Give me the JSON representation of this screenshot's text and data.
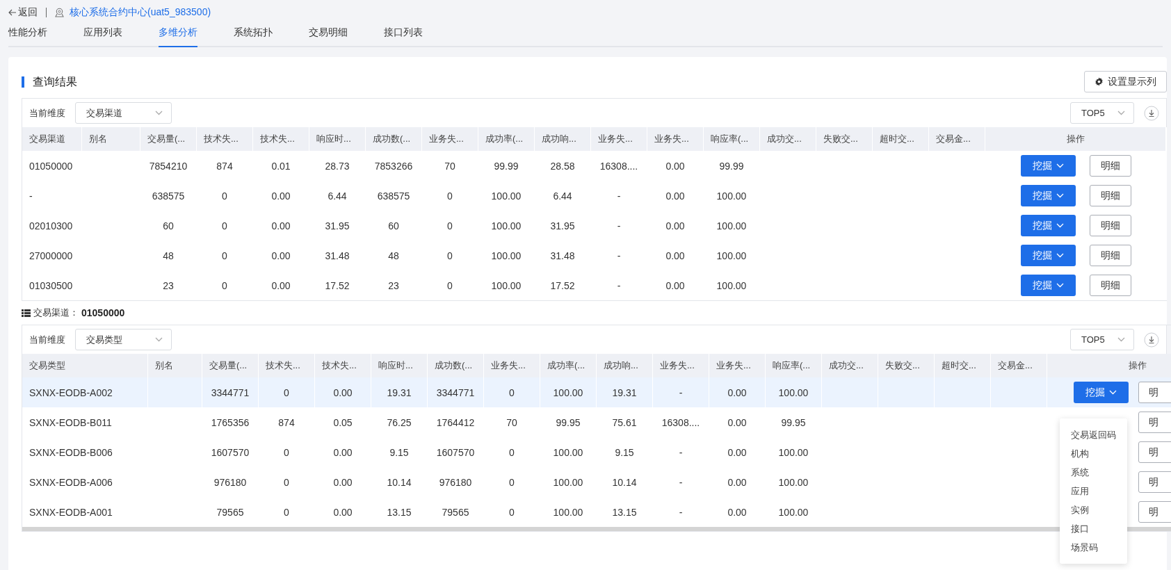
{
  "header": {
    "back": "返回",
    "app_name": "核心系统合约中心(uat5_983500)"
  },
  "tabs": [
    {
      "label": "性能分析",
      "selected": false
    },
    {
      "label": "应用列表",
      "selected": false
    },
    {
      "label": "多维分析",
      "selected": true
    },
    {
      "label": "系统拓扑",
      "selected": false
    },
    {
      "label": "交易明细",
      "selected": false
    },
    {
      "label": "接口列表",
      "selected": false
    }
  ],
  "section_title": "查询结果",
  "settings_button": "设置显示列",
  "tables": [
    {
      "dimension_label": "当前维度",
      "dimension_value": "交易渠道",
      "top_value": "TOP5",
      "columns": [
        "交易渠道",
        "别名",
        "交易量(...",
        "技术失...",
        "技术失...",
        "响应时...",
        "成功数(...",
        "业务失...",
        "成功率(...",
        "成功响...",
        "业务失...",
        "业务失...",
        "响应率(...",
        "成功交...",
        "失败交...",
        "超时交...",
        "交易金...",
        "操作"
      ],
      "rows": [
        {
          "selected": false,
          "cells": [
            "01050000",
            null,
            "7854210",
            "874",
            "0.01",
            "28.73",
            "7853266",
            "70",
            "99.99",
            "28.58",
            "16308....",
            "0.00",
            "99.99"
          ],
          "actions": [
            {
              "kind": "drill",
              "label": "挖掘"
            },
            {
              "kind": "detail",
              "label": "明细"
            }
          ]
        },
        {
          "selected": false,
          "cells": [
            "-",
            null,
            "638575",
            "0",
            "0.00",
            "6.44",
            "638575",
            "0",
            "100.00",
            "6.44",
            "-",
            "0.00",
            "100.00"
          ],
          "actions": [
            {
              "kind": "drill",
              "label": "挖掘"
            },
            {
              "kind": "detail",
              "label": "明细"
            }
          ]
        },
        {
          "selected": false,
          "cells": [
            "02010300",
            null,
            "60",
            "0",
            "0.00",
            "31.95",
            "60",
            "0",
            "100.00",
            "31.95",
            "-",
            "0.00",
            "100.00"
          ],
          "actions": [
            {
              "kind": "drill",
              "label": "挖掘"
            },
            {
              "kind": "detail",
              "label": "明细"
            }
          ]
        },
        {
          "selected": false,
          "cells": [
            "27000000",
            null,
            "48",
            "0",
            "0.00",
            "31.48",
            "48",
            "0",
            "100.00",
            "31.48",
            "-",
            "0.00",
            "100.00"
          ],
          "actions": [
            {
              "kind": "drill",
              "label": "挖掘"
            },
            {
              "kind": "detail",
              "label": "明细"
            }
          ]
        },
        {
          "selected": false,
          "cells": [
            "01030500",
            null,
            "23",
            "0",
            "0.00",
            "17.52",
            "23",
            "0",
            "100.00",
            "17.52",
            "-",
            "0.00",
            "100.00"
          ],
          "actions": [
            {
              "kind": "drill",
              "label": "挖掘"
            },
            {
              "kind": "detail",
              "label": "明细"
            }
          ]
        }
      ]
    },
    {
      "caption_label": "交易渠道：",
      "caption_value": "01050000",
      "dimension_label": "当前维度",
      "dimension_value": "交易类型",
      "top_value": "TOP5",
      "columns": [
        "交易类型",
        "别名",
        "交易量(...",
        "技术失...",
        "技术失...",
        "响应时...",
        "成功数(...",
        "业务失...",
        "成功率(...",
        "成功响...",
        "业务失...",
        "业务失...",
        "响应率(...",
        "成功交...",
        "失败交...",
        "超时交...",
        "交易金...",
        "操作"
      ],
      "rows": [
        {
          "selected": true,
          "cells": [
            "SXNX-EODB-A002",
            null,
            "3344771",
            "0",
            "0.00",
            "19.31",
            "3344771",
            "0",
            "100.00",
            "19.31",
            "-",
            "0.00",
            "100.00"
          ],
          "actions": [
            {
              "kind": "drill",
              "label": "挖掘"
            },
            {
              "kind": "detail",
              "label": "明"
            }
          ]
        },
        {
          "selected": false,
          "cells": [
            "SXNX-EODB-B011",
            null,
            "1765356",
            "874",
            "0.05",
            "76.25",
            "1764412",
            "70",
            "99.95",
            "75.61",
            "16308....",
            "0.00",
            "99.95"
          ],
          "actions": [
            {
              "kind": "detail",
              "label": "明"
            }
          ]
        },
        {
          "selected": false,
          "cells": [
            "SXNX-EODB-B006",
            null,
            "1607570",
            "0",
            "0.00",
            "9.15",
            "1607570",
            "0",
            "100.00",
            "9.15",
            "-",
            "0.00",
            "100.00"
          ],
          "actions": [
            {
              "kind": "detail",
              "label": "明"
            }
          ]
        },
        {
          "selected": false,
          "cells": [
            "SXNX-EODB-A006",
            null,
            "976180",
            "0",
            "0.00",
            "10.14",
            "976180",
            "0",
            "100.00",
            "10.14",
            "-",
            "0.00",
            "100.00"
          ],
          "actions": [
            {
              "kind": "detail",
              "label": "明"
            }
          ]
        },
        {
          "selected": false,
          "cells": [
            "SXNX-EODB-A001",
            null,
            "79565",
            "0",
            "0.00",
            "13.15",
            "79565",
            "0",
            "100.00",
            "13.15",
            "-",
            "0.00",
            "100.00"
          ],
          "actions": [
            {
              "kind": "detail",
              "label": "明"
            }
          ]
        }
      ],
      "menu": [
        "交易返回码",
        "机构",
        "系统",
        "应用",
        "实例",
        "接口",
        "场景码"
      ]
    }
  ]
}
